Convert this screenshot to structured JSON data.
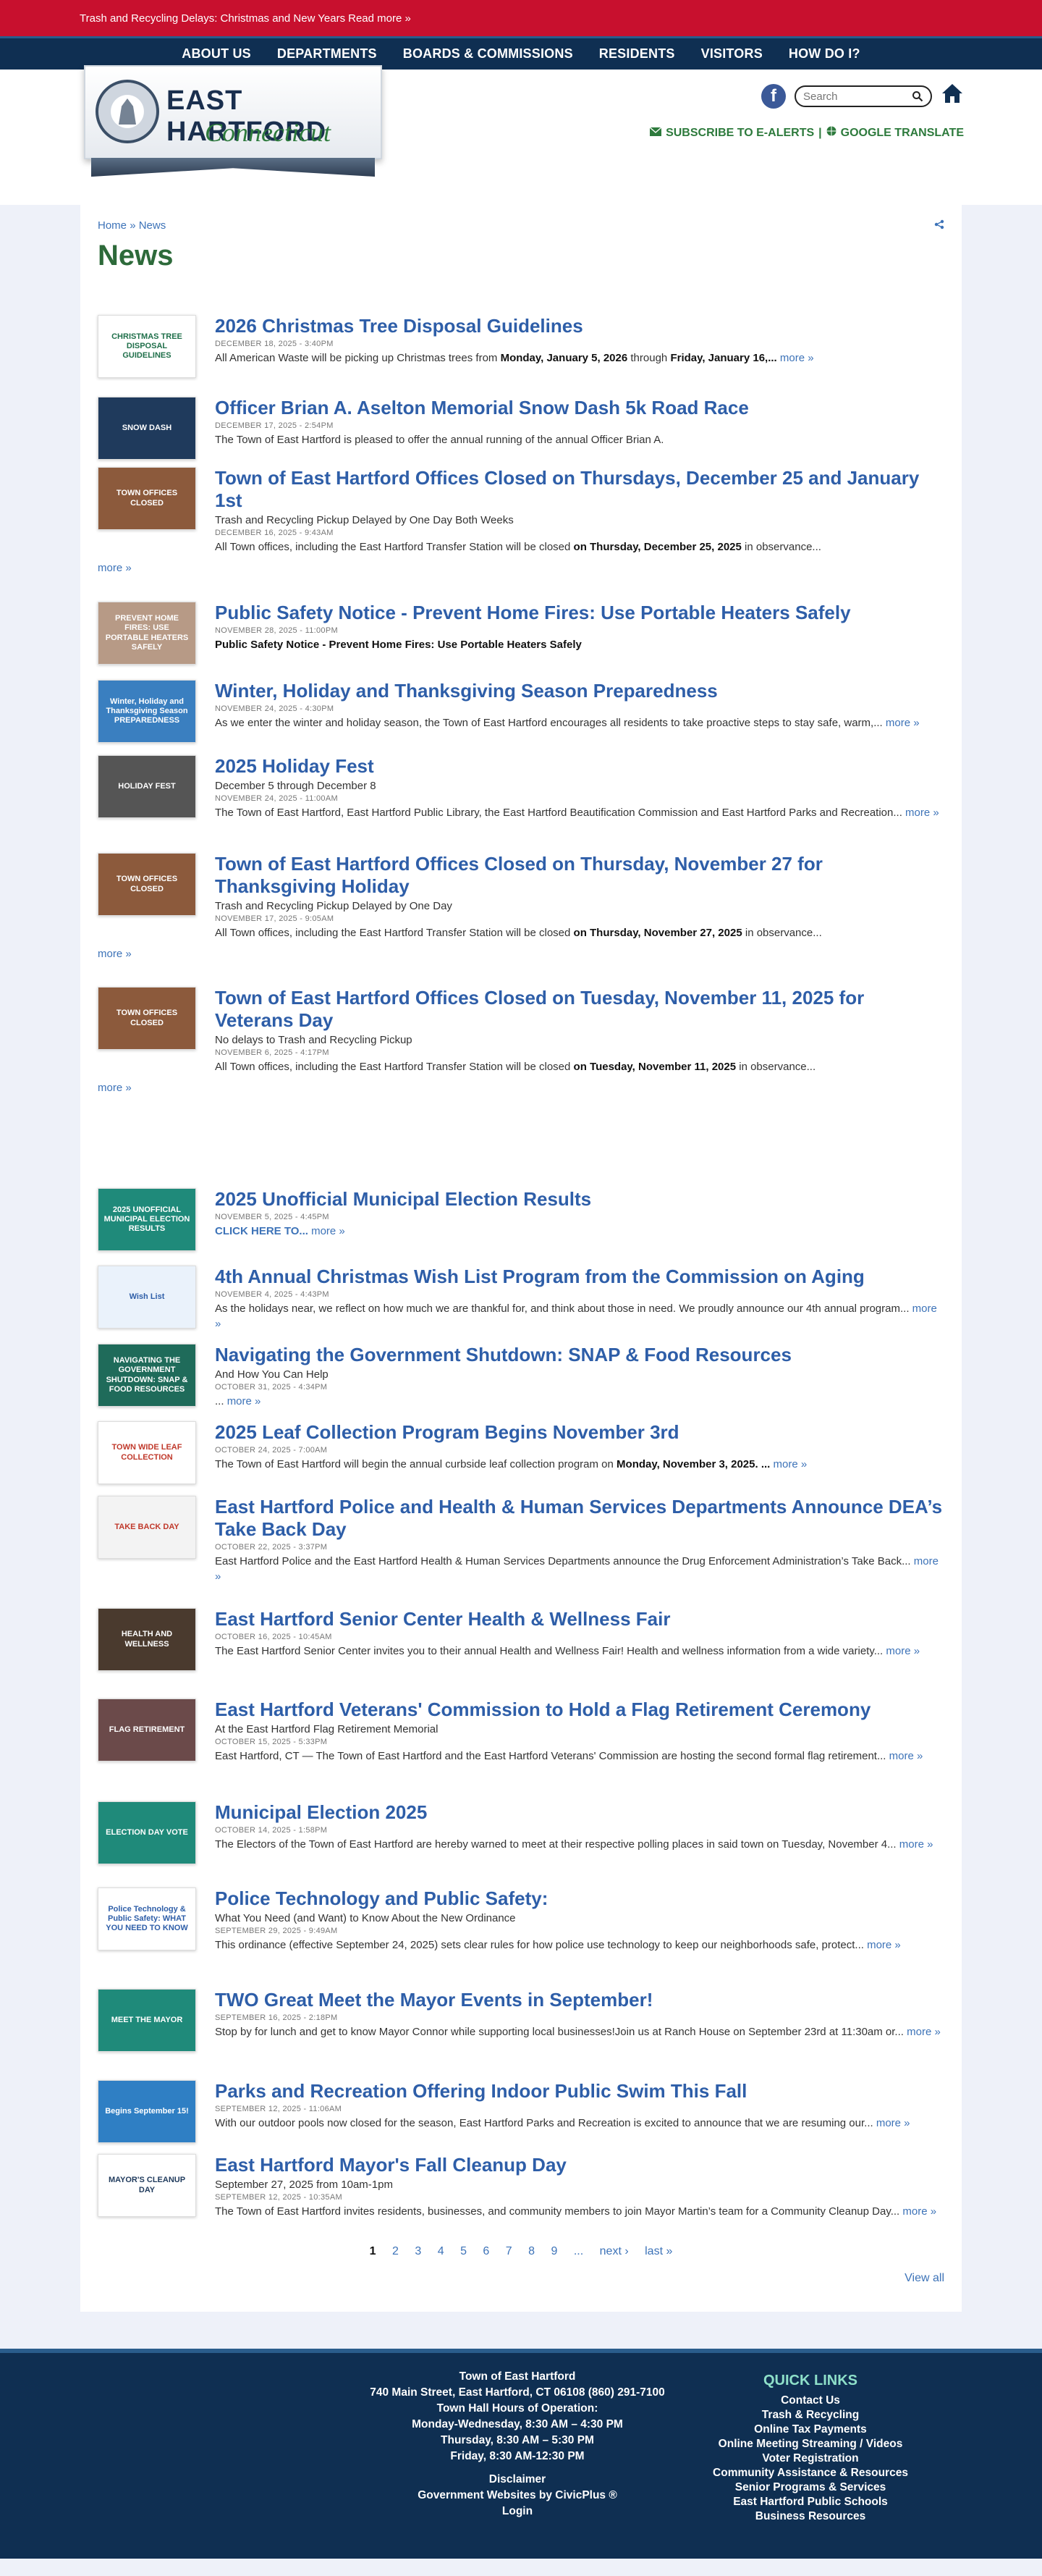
{
  "alert": {
    "text": "Trash and Recycling Delays: Christmas and New Years",
    "more": "Read more »"
  },
  "nav": [
    "ABOUT US",
    "DEPARTMENTS",
    "BOARDS & COMMISSIONS",
    "RESIDENTS",
    "VISITORS",
    "HOW DO I?"
  ],
  "header": {
    "logo_title": "EAST HARTFORD",
    "logo_sub": "Connecticut",
    "search_placeholder": "Search",
    "alerts_link": "SUBSCRIBE TO E-ALERTS",
    "separator": "|",
    "translate_link": "GOOGLE TRANSLATE"
  },
  "breadcrumb": {
    "home": "Home",
    "sep": "»",
    "current": "News"
  },
  "page_title": "News",
  "news": [
    {
      "title": "2026 Christmas Tree Disposal Guidelines",
      "date": "DECEMBER 18, 2025 - 3:40PM",
      "teaser_pre": "All American Waste will be picking up Christmas trees from ",
      "bold1": "Monday, January 5, 2026",
      "teaser_mid": " through ",
      "bold2": "Friday, January 16,...",
      "more": "more »",
      "thumb": "CHRISTMAS TREE DISPOSAL GUIDELINES",
      "thumb_bg": "#ffffff",
      "thumb_fg": "#1f6f4a"
    },
    {
      "title": "Officer Brian A. Aselton Memorial Snow Dash 5k Road Race",
      "date": "DECEMBER 17, 2025 - 2:54PM",
      "teaser": "The Town of East Hartford is pleased to offer the annual running of the annual Officer Brian A.",
      "thumb": "SNOW DASH",
      "thumb_bg": "#1f3a5c",
      "thumb_fg": "#ffffff"
    },
    {
      "title": "Town of East Hartford Offices Closed on Thursdays, December 25 and January 1st",
      "sub": "Trash and Recycling Pickup Delayed by One Day Both Weeks",
      "date": "DECEMBER 16, 2025 - 9:43AM",
      "teaser_pre": "All Town offices, including the East Hartford Transfer Station will be closed ",
      "bold1": "on Thursday, December 25, 2025",
      "teaser_post": " in observance...",
      "more_outer": "more »",
      "thumb": "TOWN OFFICES CLOSED",
      "thumb_bg": "#8c5a3c",
      "thumb_fg": "#ffffff"
    },
    {
      "title": "Public Safety Notice - Prevent Home Fires: Use Portable Heaters Safely",
      "date": "NOVEMBER 28, 2025 - 11:00PM",
      "teaser_bold": "Public Safety Notice - Prevent Home Fires: Use Portable Heaters Safely",
      "thumb": "PREVENT HOME FIRES: USE PORTABLE HEATERS SAFELY",
      "thumb_bg": "#b79a86",
      "thumb_fg": "#ffffff"
    },
    {
      "title": "Winter, Holiday and Thanksgiving Season Preparedness",
      "date": "NOVEMBER 24, 2025 - 4:30PM",
      "teaser": "As we enter the winter and holiday season, the Town of East Hartford encourages all residents to take proactive steps to stay safe, warm,...",
      "more": "more »",
      "thumb": "Winter, Holiday and Thanksgiving Season PREPAREDNESS",
      "thumb_bg": "#3a7fc0",
      "thumb_fg": "#ffffff"
    },
    {
      "title": "2025 Holiday Fest",
      "sub": "December 5 through December 8",
      "date": "NOVEMBER 24, 2025 - 11:00AM",
      "teaser": "The Town of East Hartford, East Hartford Public Library, the East Hartford Beautification Commission and East Hartford Parks and Recreation...",
      "more": "more »",
      "thumb": "HOLIDAY FEST",
      "thumb_bg": "#555555",
      "thumb_fg": "#ffffff"
    },
    {
      "title": "Town of East Hartford Offices Closed on Thursday, November 27 for Thanksgiving Holiday",
      "sub": "Trash and Recycling Pickup Delayed by One Day",
      "date": "NOVEMBER 17, 2025 - 9:05AM",
      "teaser_pre": "All Town offices, including the East Hartford Transfer Station will be closed ",
      "bold1": "on Thursday, November 27, 2025",
      "teaser_post": " in observance...",
      "more_outer": "more »",
      "thumb": "TOWN OFFICES CLOSED",
      "thumb_bg": "#8c5a3c",
      "thumb_fg": "#ffffff"
    },
    {
      "title": "Town of East Hartford Offices Closed on Tuesday, November 11, 2025 for Veterans Day",
      "sub": "No delays to Trash and Recycling Pickup",
      "date": "NOVEMBER 6, 2025 - 4:17PM",
      "teaser_pre": "All Town offices, including the East Hartford Transfer Station will be closed ",
      "bold1": "on Tuesday, November 11, 2025",
      "teaser_post": " in observance...",
      "more_outer": "more »",
      "thumb": "TOWN OFFICES CLOSED",
      "thumb_bg": "#8c5a3c",
      "thumb_fg": "#ffffff"
    },
    {
      "title": "2025 Unofficial Municipal Election Results",
      "date": "NOVEMBER 5, 2025 - 4:45PM",
      "teaser_link": "CLICK HERE TO...",
      "more": "more »",
      "thumb": "2025 UNOFFICIAL MUNICIPAL ELECTION RESULTS",
      "thumb_bg": "#1f8a7a",
      "thumb_fg": "#ffffff"
    },
    {
      "title": "4th Annual Christmas Wish List Program from the Commission on Aging",
      "date": "NOVEMBER 4, 2025 - 4:43PM",
      "teaser": "As the holidays near, we reflect on how much we are thankful for, and think about those in need. We proudly announce our 4th annual program...",
      "more": "more »",
      "thumb": "Wish List",
      "thumb_bg": "#eaf2fb",
      "thumb_fg": "#2e5ea8"
    },
    {
      "title": "Navigating the Government Shutdown: SNAP & Food Resources",
      "sub": "And How You Can Help",
      "date": "OCTOBER 31, 2025 - 4:34PM",
      "teaser": "...",
      "more": "more »",
      "thumb": "NAVIGATING THE GOVERNMENT SHUTDOWN: SNAP & FOOD RESOURCES",
      "thumb_bg": "#1f6b5a",
      "thumb_fg": "#ffffff"
    },
    {
      "title": "2025 Leaf Collection Program Begins November 3rd",
      "date": "OCTOBER 24, 2025 - 7:00AM",
      "teaser_pre": "The Town of East Hartford will begin the annual curbside leaf collection program on ",
      "bold1": "Monday, November 3, 2025. ...",
      "more": "more »",
      "thumb": "TOWN WIDE LEAF COLLECTION",
      "thumb_bg": "#ffffff",
      "thumb_fg": "#c0392b"
    },
    {
      "title": "East Hartford Police and Health & Human Services Departments Announce DEA’s Take Back Day",
      "date": "OCTOBER 22, 2025 - 3:37PM",
      "teaser": "East Hartford Police and the East Hartford Health & Human Services Departments announce the Drug Enforcement Administration’s Take Back...",
      "more": "more »",
      "thumb": "TAKE BACK DAY",
      "thumb_bg": "#f3f3f3",
      "thumb_fg": "#c0392b"
    },
    {
      "title": "East Hartford Senior Center Health & Wellness Fair",
      "date": "OCTOBER 16, 2025 - 10:45AM",
      "teaser": "The East Hartford Senior Center invites you to their annual Health and Wellness Fair! Health and wellness information from a wide variety...",
      "more": "more »",
      "thumb": "HEALTH AND WELLNESS",
      "thumb_bg": "#4a3a2e",
      "thumb_fg": "#ffffff"
    },
    {
      "title": "East Hartford Veterans' Commission to Hold a Flag Retirement Ceremony",
      "sub": "At the East Hartford Flag Retirement Memorial",
      "date": "OCTOBER 15, 2025 - 5:33PM",
      "teaser": "East Hartford, CT — The Town of East Hartford and the East Hartford Veterans' Commission are hosting the second formal flag retirement...",
      "more": "more »",
      "thumb": "FLAG RETIREMENT",
      "thumb_bg": "#6b4a4a",
      "thumb_fg": "#ffffff"
    },
    {
      "title": "Municipal Election 2025",
      "date": "OCTOBER 14, 2025 - 1:58PM",
      "teaser": "The Electors of the Town of East Hartford are hereby warned to meet at their respective polling places in said town on Tuesday, November 4...",
      "more": "more »",
      "thumb": "ELECTION DAY VOTE",
      "thumb_bg": "#1f8a7a",
      "thumb_fg": "#ffffff"
    },
    {
      "title": "Police Technology and Public Safety:",
      "sub": "What You Need (and Want) to Know About the New Ordinance",
      "date": "SEPTEMBER 29, 2025 - 9:49AM",
      "teaser": "This ordinance (effective September 24, 2025) sets clear rules for how police use technology to keep our neighborhoods safe, protect...",
      "more": "more »",
      "thumb": "Police Technology & Public Safety: WHAT YOU NEED TO KNOW",
      "thumb_bg": "#ffffff",
      "thumb_fg": "#2e5ea8"
    },
    {
      "title": "TWO Great Meet the Mayor Events in September!",
      "date": "SEPTEMBER 16, 2025 - 2:18PM",
      "teaser": "Stop by for lunch and get to know Mayor Connor while supporting local businesses!Join us at Ranch House on September 23rd at 11:30am or...",
      "more": "more »",
      "thumb": "MEET THE MAYOR",
      "thumb_bg": "#1f8a7a",
      "thumb_fg": "#ffffff"
    },
    {
      "title": "Parks and Recreation Offering Indoor Public Swim This Fall",
      "date": "SEPTEMBER 12, 2025 - 11:06AM",
      "teaser": "With our outdoor pools now closed for the season, East Hartford Parks and Recreation is excited to announce that we are resuming our...",
      "more": "more »",
      "thumb": "Begins September 15!",
      "thumb_bg": "#2f7fc4",
      "thumb_fg": "#ffffff"
    },
    {
      "title": "East Hartford Mayor's Fall Cleanup Day",
      "sub": "September 27, 2025 from 10am-1pm",
      "date": "SEPTEMBER 12, 2025 - 10:35AM",
      "teaser": "The Town of East Hartford invites residents, businesses, and community members to join Mayor Martin’s team for a Community Cleanup Day...",
      "more": "more »",
      "thumb": "MAYOR'S CLEANUP DAY",
      "thumb_bg": "#ffffff",
      "thumb_fg": "#1f3a5c"
    }
  ],
  "pagination": {
    "pages": [
      "1",
      "2",
      "3",
      "4",
      "5",
      "6",
      "7",
      "8",
      "9"
    ],
    "ellipsis": "...",
    "next": "next ›",
    "last": "last »"
  },
  "view_all": "View all",
  "footer": {
    "lines": [
      "Town of East Hartford",
      "740 Main Street, East Hartford, CT 06108  (860) 291-7100",
      "Town Hall Hours of Operation:",
      "Monday-Wednesday, 8:30 AM – 4:30 PM",
      "Thursday, 8:30 AM – 5:30 PM",
      "Friday, 8:30 AM-12:30 PM"
    ],
    "disclaimer": "Disclaimer",
    "civicplus": "Government Websites by CivicPlus ®",
    "login": "Login",
    "quick_title": "QUICK LINKS",
    "quick_links": [
      "Contact Us",
      "Trash & Recycling",
      "Online Tax Payments",
      "Online Meeting Streaming / Videos",
      "Voter Registration",
      "Community Assistance & Resources",
      "Senior Programs & Services",
      "East Hartford Public Schools",
      "Business Resources"
    ]
  }
}
